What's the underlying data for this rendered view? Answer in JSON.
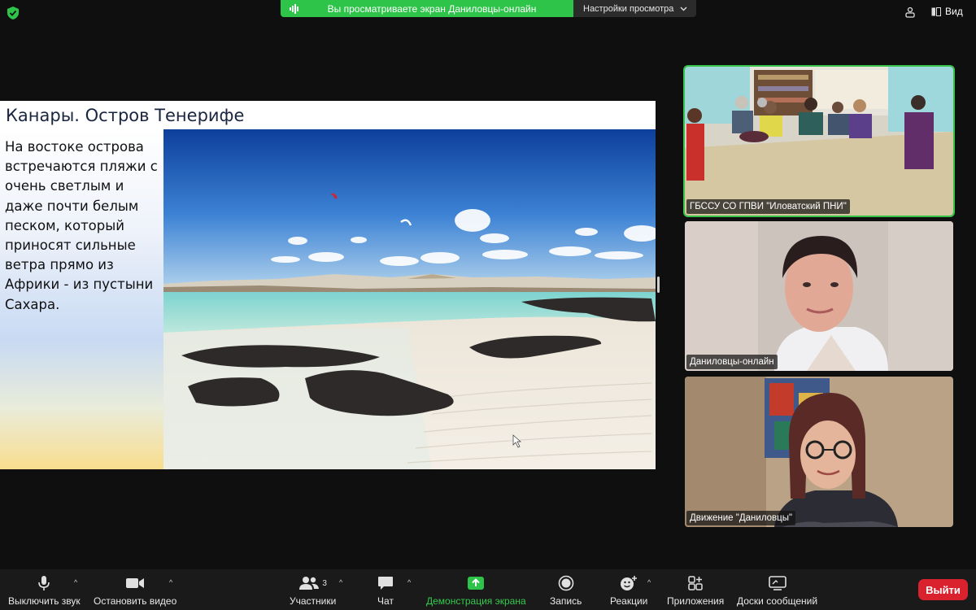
{
  "topbar": {
    "share_banner_text": "Вы просматриваете экран Даниловцы-онлайн",
    "view_options_label": "Настройки просмотра",
    "view_label": "Вид"
  },
  "slide": {
    "title": "Канары. Остров Тенерифе",
    "text": "На востоке острова встречаются пляжи с очень светлым и даже почти белым песком, который приносят сильные ветра прямо из Африки - из пустыни Сахара."
  },
  "participants": [
    {
      "name": "ГБССУ СО ГПВИ \"Иловатский ПНИ\"",
      "active": true
    },
    {
      "name": "Даниловцы-онлайн",
      "active": false
    },
    {
      "name": "Движение \"Даниловцы\"",
      "active": false
    }
  ],
  "toolbar": {
    "mute_label": "Выключить звук",
    "video_label": "Остановить видео",
    "participants_label": "Участники",
    "participants_count": "3",
    "chat_label": "Чат",
    "share_label": "Демонстрация экрана",
    "record_label": "Запись",
    "reactions_label": "Реакции",
    "apps_label": "Приложения",
    "whiteboards_label": "Доски сообщений",
    "exit_label": "Выйти"
  },
  "colors": {
    "accent_green": "#2ec44a",
    "exit_red": "#d9222e",
    "background": "#0f0f0f"
  }
}
